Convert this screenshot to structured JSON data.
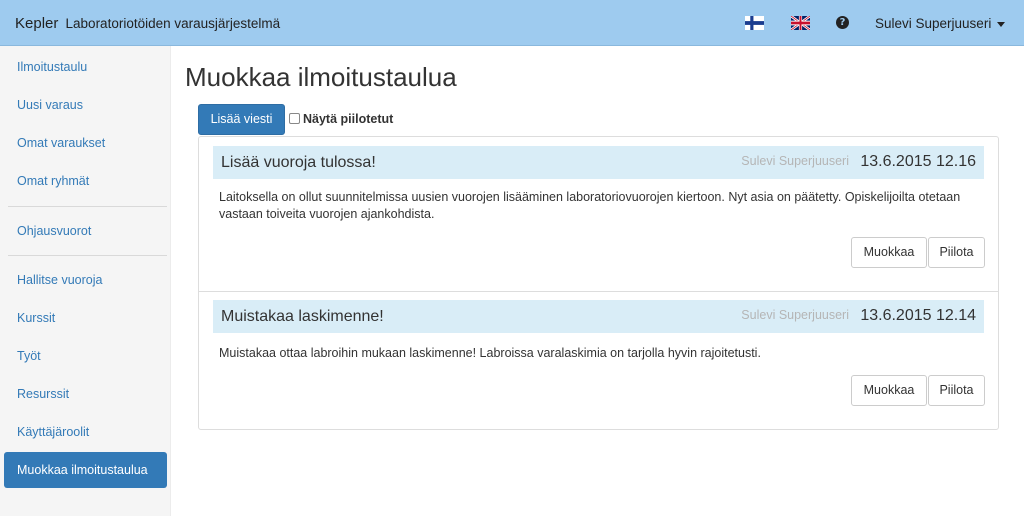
{
  "navbar": {
    "brand_name": "Kepler",
    "brand_subtitle": "Laboratoriotöiden varausjärjestelmä",
    "flag_fi_icon": "flag-finland-icon",
    "flag_uk_icon": "flag-uk-icon",
    "help_icon": "question-circle-icon",
    "help_glyph": "?",
    "user_name": "Sulevi Superjuuseri"
  },
  "sidebar": {
    "items": [
      {
        "label": "Ilmoitustaulu",
        "active": false
      },
      {
        "label": "Uusi varaus",
        "active": false
      },
      {
        "label": "Omat varaukset",
        "active": false
      },
      {
        "label": "Omat ryhmät",
        "active": false
      },
      {
        "label": "Ohjausvuorot",
        "active": false
      },
      {
        "label": "Hallitse vuoroja",
        "active": false
      },
      {
        "label": "Kurssit",
        "active": false
      },
      {
        "label": "Työt",
        "active": false
      },
      {
        "label": "Resurssit",
        "active": false
      },
      {
        "label": "Käyttäjäroolit",
        "active": false
      },
      {
        "label": "Muokkaa ilmoitustaulua",
        "active": true
      }
    ]
  },
  "main": {
    "title": "Muokkaa ilmoitustaulua",
    "add_button": "Lisää viesti",
    "show_hidden_label": "Näytä piilotetut",
    "show_hidden_checked": false
  },
  "messages": [
    {
      "title": "Lisää vuoroja tulossa!",
      "author": "Sulevi Superjuuseri",
      "date": "13.6.2015 12.16",
      "body": "Laitoksella on ollut suunnitelmissa uusien vuorojen lisääminen laboratoriovuorojen kiertoon. Nyt asia on päätetty. Opiskelijoilta otetaan vastaan toiveita vuorojen ajankohdista.",
      "edit_label": "Muokkaa",
      "hide_label": "Piilota"
    },
    {
      "title": "Muistakaa laskimenne!",
      "author": "Sulevi Superjuuseri",
      "date": "13.6.2015 12.14",
      "body": "Muistakaa ottaa labroihin mukaan laskimenne! Labroissa varalaskimia on tarjolla hyvin rajoitetusti.",
      "edit_label": "Muokkaa",
      "hide_label": "Piilota"
    }
  ],
  "colors": {
    "navbar_bg": "#9ecbef",
    "primary": "#337ab7",
    "heading_bg": "#d9edf7",
    "sidebar_bg": "#f5f5f5"
  }
}
